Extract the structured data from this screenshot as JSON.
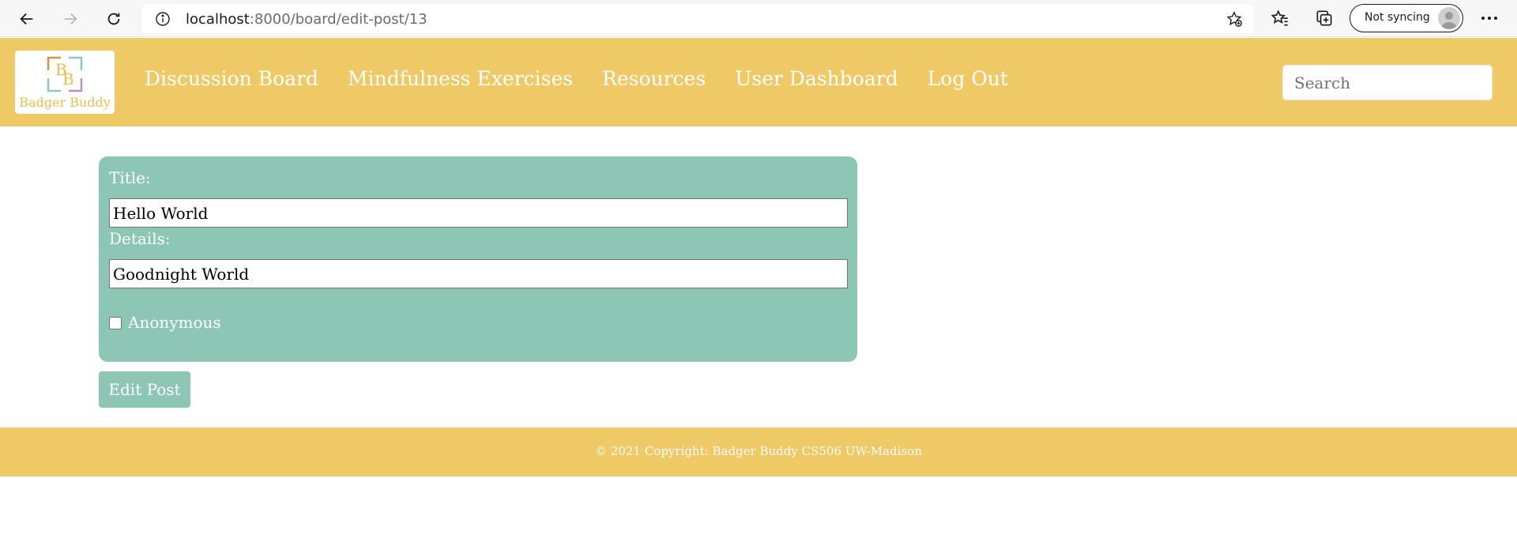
{
  "browser": {
    "url_host": "localhost",
    "url_path": ":8000/board/edit-post/13",
    "sync_label": "Not syncing"
  },
  "site": {
    "logo_text": "Badger Buddy",
    "nav": [
      {
        "label": "Discussion Board"
      },
      {
        "label": "Mindfulness Exercises"
      },
      {
        "label": "Resources"
      },
      {
        "label": "User Dashboard"
      },
      {
        "label": "Log Out"
      }
    ],
    "search_placeholder": "Search"
  },
  "form": {
    "title_label": "Title:",
    "title_value": "Hello World",
    "details_label": "Details:",
    "details_value": "Goodnight World",
    "anonymous_label": "Anonymous",
    "anonymous_checked": false,
    "submit_label": "Edit Post"
  },
  "footer": {
    "text": "© 2021 Copyright: Badger Buddy CS506 UW-Madison"
  },
  "colors": {
    "header_bg": "#eec965",
    "card_bg": "#8dc6b5",
    "text_on_color": "#ffffff"
  }
}
